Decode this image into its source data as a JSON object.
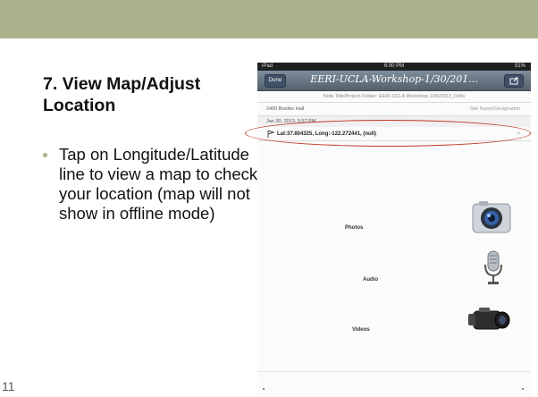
{
  "slide": {
    "title": "7. View Map/Adjust Location",
    "bullet": "Tap on Longitude/Latitude line to view a map to check your location (map will not show in offline mode)",
    "number": "11"
  },
  "ipad": {
    "status": {
      "left": "iPad",
      "time": "6:00 PM",
      "right": "91%"
    },
    "nav": {
      "left_button": "Done",
      "title": "EERI-UCLA-Workshop-1/30/201...",
      "right_button": "icon"
    },
    "folder_text": "Note Title/Project Folder: EERI-UCLA Workshop 1/30/2013_Drills",
    "address": "2400 Boelter Hall",
    "address_right": "Site Name/Designation",
    "date": "Jan 30, 2013, 5:57 PM",
    "coordinates": "Lat:37.804325, Long:-122.272441, (null)",
    "chevron": ">",
    "media": {
      "photos": "Photos",
      "audio": "Audio",
      "videos": "Videos"
    }
  },
  "colors": {
    "accent": "#a9b28c",
    "highlight": "#c0392b"
  }
}
